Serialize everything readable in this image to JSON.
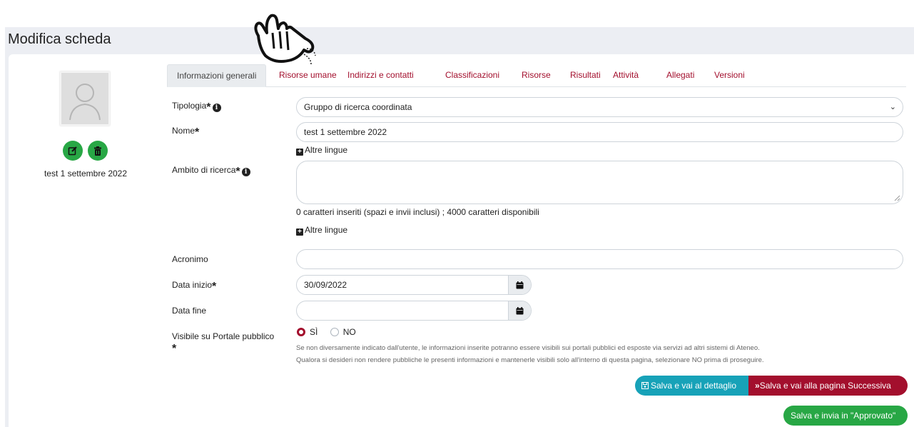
{
  "page": {
    "title": "Modifica scheda"
  },
  "profile": {
    "name": "test 1 settembre 2022",
    "avatar_icon": "user-placeholder-icon",
    "edit_icon": "edit-icon",
    "delete_icon": "trash-icon"
  },
  "tabs": [
    {
      "label": "Informazioni generali",
      "active": true
    },
    {
      "label": "Risorse umane"
    },
    {
      "label": "Indirizzi e contatti"
    },
    {
      "label": "Classificazioni"
    },
    {
      "label": "Risorse"
    },
    {
      "label": "Risultati"
    },
    {
      "label": "Attività"
    },
    {
      "label": "Allegati"
    },
    {
      "label": "Versioni"
    }
  ],
  "form": {
    "tipologia": {
      "label": "Tipologia",
      "value": "Gruppo di ricerca coordinata"
    },
    "nome": {
      "label": "Nome",
      "value": "test 1 settembre 2022"
    },
    "altre_lingue": "Altre lingue",
    "ambito": {
      "label": "Ambito di ricerca",
      "value": "",
      "counter": "0 caratteri inseriti (spazi e invii inclusi) ; 4000 caratteri disponibili"
    },
    "acronimo": {
      "label": "Acronimo",
      "value": ""
    },
    "data_inizio": {
      "label": "Data inizio",
      "value": "30/09/2022"
    },
    "data_fine": {
      "label": "Data fine",
      "value": ""
    },
    "visibile": {
      "label": "Visibile su Portale pubblico",
      "options": [
        "SÌ",
        "NO"
      ],
      "selected": "SÌ",
      "help_1": "Se non diversamente indicato dall'utente, le informazioni inserite potranno essere visibili sui portali pubblici ed esposte via servizi ad altri sistemi di Ateneo.",
      "help_2": "Qualora si desideri non rendere pubbliche le presenti informazioni e mantenerle visibili solo all'interno di questa pagina, selezionare NO prima di proseguire."
    },
    "required_mark": "*"
  },
  "buttons": {
    "save_detail": "Salva e vai al dettaglio",
    "save_next": "Salva e vai alla pagina Successiva",
    "save_approve": "Salva e invia in \"Approvato\""
  },
  "colors": {
    "accent": "#a30f2d",
    "info": "#17a2b8",
    "success": "#28a745",
    "band": "#eceef3"
  }
}
